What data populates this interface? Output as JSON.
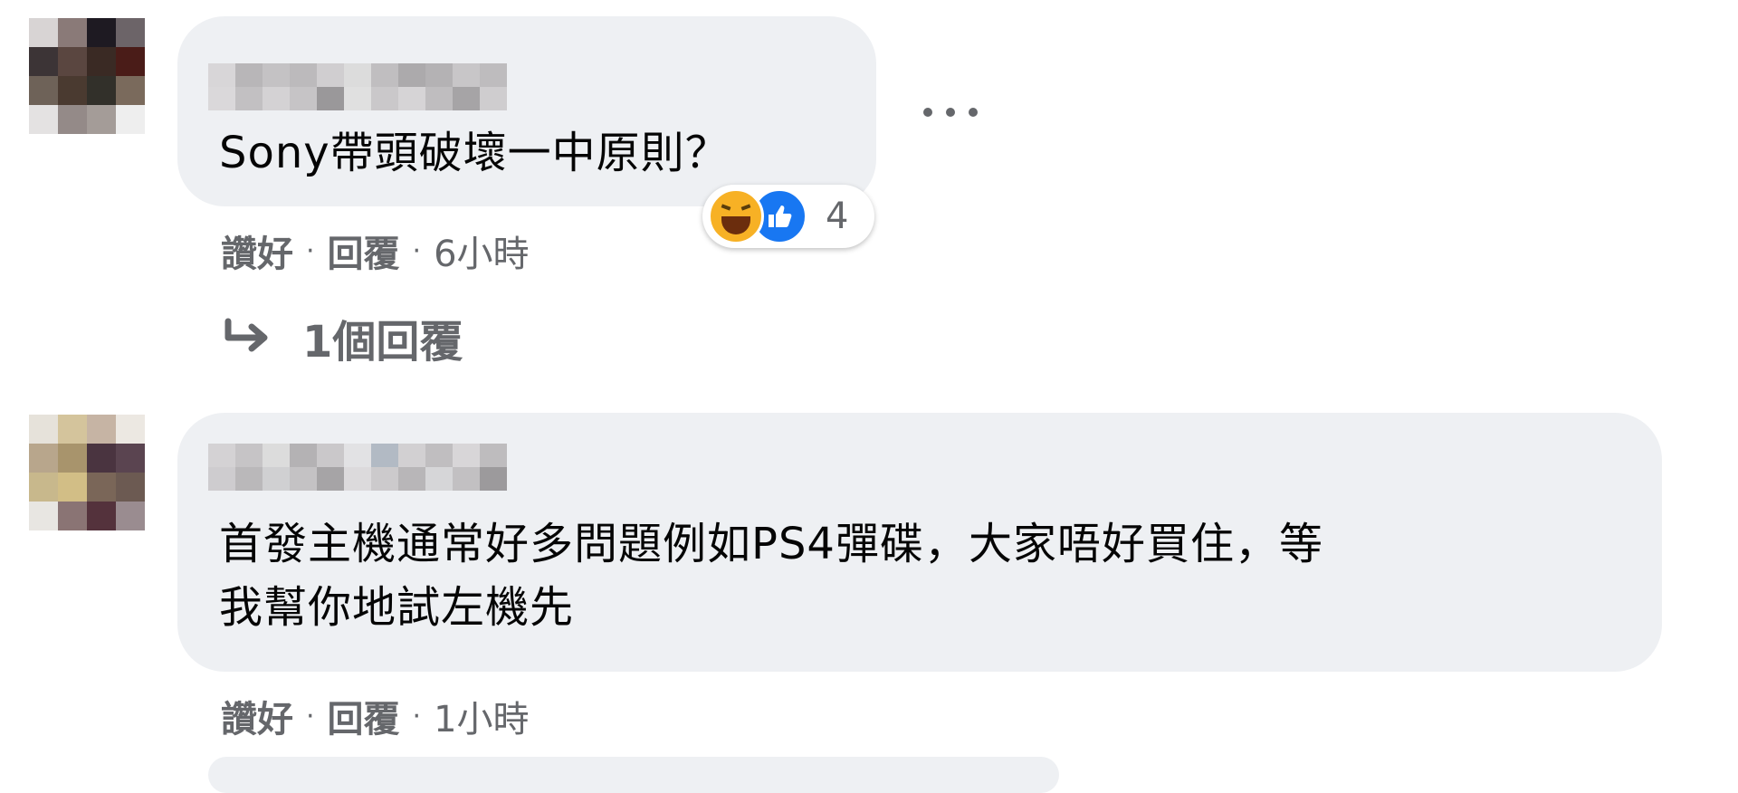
{
  "comments": [
    {
      "text": "Sony帶頭破壞一中原則？",
      "like_label": "讚好",
      "reply_label": "回覆",
      "time": "6小時",
      "reactions": {
        "types": [
          "haha-icon",
          "like-icon"
        ],
        "count": "4"
      },
      "replies_link": "1個回覆"
    },
    {
      "text": "首發主機通常好多問題例如PS4彈碟，大家唔好買住，等\n我幫你地試左機先",
      "like_label": "讚好",
      "reply_label": "回覆",
      "time": "1小時"
    }
  ],
  "colors": {
    "bubble": "#eef0f3",
    "secondary_text": "#65676b",
    "like_blue": "#1877f2",
    "haha_yellow": "#f7b125"
  }
}
